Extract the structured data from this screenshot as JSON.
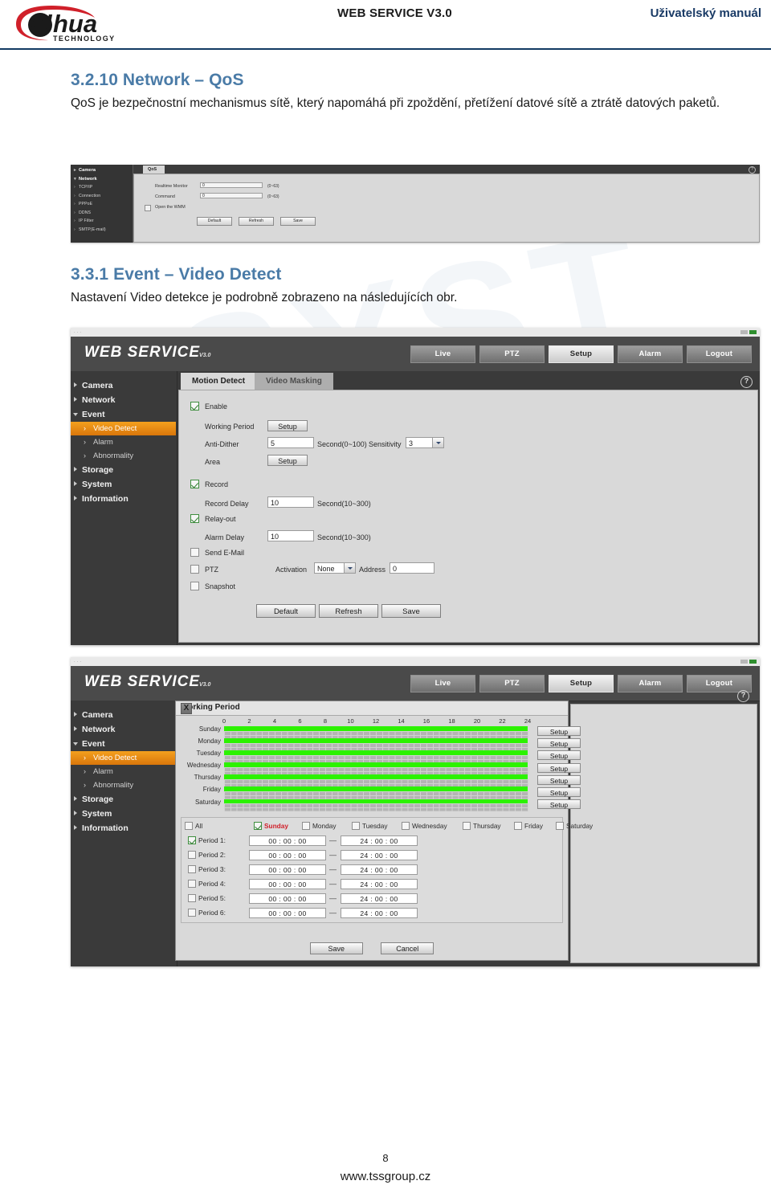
{
  "header": {
    "logo_text": "alhua",
    "logo_sub": "TECHNOLOGY",
    "center_title": "WEB SERVICE V3.0",
    "right_title": "Uživatelský manuál"
  },
  "sections": [
    {
      "number_title": "3.2.10 Network – QoS",
      "paragraph": "QoS je bezpečnostní mechanismus sítě, který napomáhá při zpoždění, přetížení datové sítě a ztrátě datových paketů."
    },
    {
      "number_title": "3.3.1 Event – Video Detect",
      "paragraph": "Nastavení Video detekce je podrobně zobrazeno na následujících obr."
    }
  ],
  "qos_panel": {
    "sidebar": [
      {
        "label": "Camera",
        "level": "top",
        "marker": "▸"
      },
      {
        "label": "Network",
        "level": "top",
        "marker": "▾"
      },
      {
        "label": "TCP/IP",
        "level": "sub",
        "marker": "＞"
      },
      {
        "label": "Connection",
        "level": "sub",
        "marker": "＞"
      },
      {
        "label": "PPPoE",
        "level": "sub",
        "marker": "＞"
      },
      {
        "label": "DDNS",
        "level": "sub",
        "marker": "＞"
      },
      {
        "label": "IP Filter",
        "level": "sub",
        "marker": "＞"
      },
      {
        "label": "SMTP(E-mail)",
        "level": "sub",
        "marker": "＞"
      }
    ],
    "tab": "QoS",
    "help_icon": "?",
    "fields": [
      {
        "label": "Realtime Monitor",
        "value": "0",
        "hint": "(0~63)"
      },
      {
        "label": "Command",
        "value": "0",
        "hint": "(0~63)"
      }
    ],
    "checkbox_wmm": "Open the WMM",
    "buttons": [
      "Default",
      "Refresh",
      "Save"
    ]
  },
  "video_detect": {
    "titlebar_dots": "···",
    "brand": "WEB SERVICE",
    "brand_version": "V3.0",
    "nav": [
      {
        "label": "Live",
        "active": false
      },
      {
        "label": "PTZ",
        "active": false
      },
      {
        "label": "Setup",
        "active": true
      },
      {
        "label": "Alarm",
        "active": false
      },
      {
        "label": "Logout",
        "active": false
      }
    ],
    "sidebar": [
      {
        "label": "Camera",
        "level": "top",
        "expanded": false
      },
      {
        "label": "Network",
        "level": "top",
        "expanded": false
      },
      {
        "label": "Event",
        "level": "top",
        "expanded": true
      },
      {
        "label": "Video Detect",
        "level": "sub",
        "selected": true
      },
      {
        "label": "Alarm",
        "level": "sub",
        "selected": false
      },
      {
        "label": "Abnormality",
        "level": "sub",
        "selected": false
      },
      {
        "label": "Storage",
        "level": "top",
        "expanded": false
      },
      {
        "label": "System",
        "level": "top",
        "expanded": false
      },
      {
        "label": "Information",
        "level": "top",
        "expanded": false
      }
    ],
    "tabs": [
      {
        "label": "Motion Detect",
        "active": true
      },
      {
        "label": "Video Masking",
        "active": false
      }
    ],
    "help_icon": "?",
    "form": {
      "enable_label": "Enable",
      "enable_checked": true,
      "working_period_label": "Working Period",
      "working_period_button": "Setup",
      "anti_dither_label": "Anti-Dither",
      "anti_dither_value": "5",
      "anti_dither_hint": "Second(0~100)",
      "sensitivity_label": "Sensitivity",
      "sensitivity_value": "3",
      "area_label": "Area",
      "area_button": "Setup",
      "record_label": "Record",
      "record_checked": true,
      "record_delay_label": "Record Delay",
      "record_delay_value": "10",
      "record_delay_hint": "Second(10~300)",
      "relay_out_label": "Relay-out",
      "relay_out_checked": true,
      "alarm_delay_label": "Alarm Delay",
      "alarm_delay_value": "10",
      "alarm_delay_hint": "Second(10~300)",
      "send_email_label": "Send E-Mail",
      "send_email_checked": false,
      "ptz_label": "PTZ",
      "ptz_checked": false,
      "activation_label": "Activation",
      "activation_value": "None",
      "address_label": "Address",
      "address_value": "0",
      "snapshot_label": "Snapshot",
      "snapshot_checked": false
    },
    "buttons": [
      "Default",
      "Refresh",
      "Save"
    ]
  },
  "working_period": {
    "dialog_title": "Working Period",
    "close_label": "X",
    "ruler_ticks": [
      "0",
      "2",
      "4",
      "6",
      "8",
      "10",
      "12",
      "14",
      "16",
      "18",
      "20",
      "22",
      "24"
    ],
    "days": [
      "Sunday",
      "Monday",
      "Tuesday",
      "Wednesday",
      "Thursday",
      "Friday",
      "Saturday"
    ],
    "setup_button": "Setup",
    "setup_buttons_count": 7,
    "all_label": "All",
    "day_checkboxes": [
      {
        "label": "Sunday",
        "checked": true,
        "highlight": true
      },
      {
        "label": "Monday",
        "checked": false,
        "highlight": false
      },
      {
        "label": "Tuesday",
        "checked": false,
        "highlight": false
      },
      {
        "label": "Wednesday",
        "checked": false,
        "highlight": false
      },
      {
        "label": "Thursday",
        "checked": false,
        "highlight": false
      },
      {
        "label": "Friday",
        "checked": false,
        "highlight": false
      },
      {
        "label": "Saturday",
        "checked": false,
        "highlight": false
      }
    ],
    "periods": [
      {
        "label": "Period 1:",
        "checked": true,
        "start": "00 : 00 : 00",
        "end": "24 : 00 : 00"
      },
      {
        "label": "Period 2:",
        "checked": false,
        "start": "00 : 00 : 00",
        "end": "24 : 00 : 00"
      },
      {
        "label": "Period 3:",
        "checked": false,
        "start": "00 : 00 : 00",
        "end": "24 : 00 : 00"
      },
      {
        "label": "Period 4:",
        "checked": false,
        "start": "00 : 00 : 00",
        "end": "24 : 00 : 00"
      },
      {
        "label": "Period 5:",
        "checked": false,
        "start": "00 : 00 : 00",
        "end": "24 : 00 : 00"
      },
      {
        "label": "Period 6:",
        "checked": false,
        "start": "00 : 00 : 00",
        "end": "24 : 00 : 00"
      }
    ],
    "dash": "—",
    "dialog_buttons": [
      "Save",
      "Cancel"
    ]
  },
  "watermark": "SYST",
  "footer": {
    "page_number": "8",
    "site": "www.tssgroup.cz"
  },
  "colors": {
    "heading": "#4a7ba7",
    "brand_red": "#d0202a",
    "accent_orange": "#e8890f",
    "schedule_green": "#2cf200",
    "header_rule": "#123a63"
  }
}
